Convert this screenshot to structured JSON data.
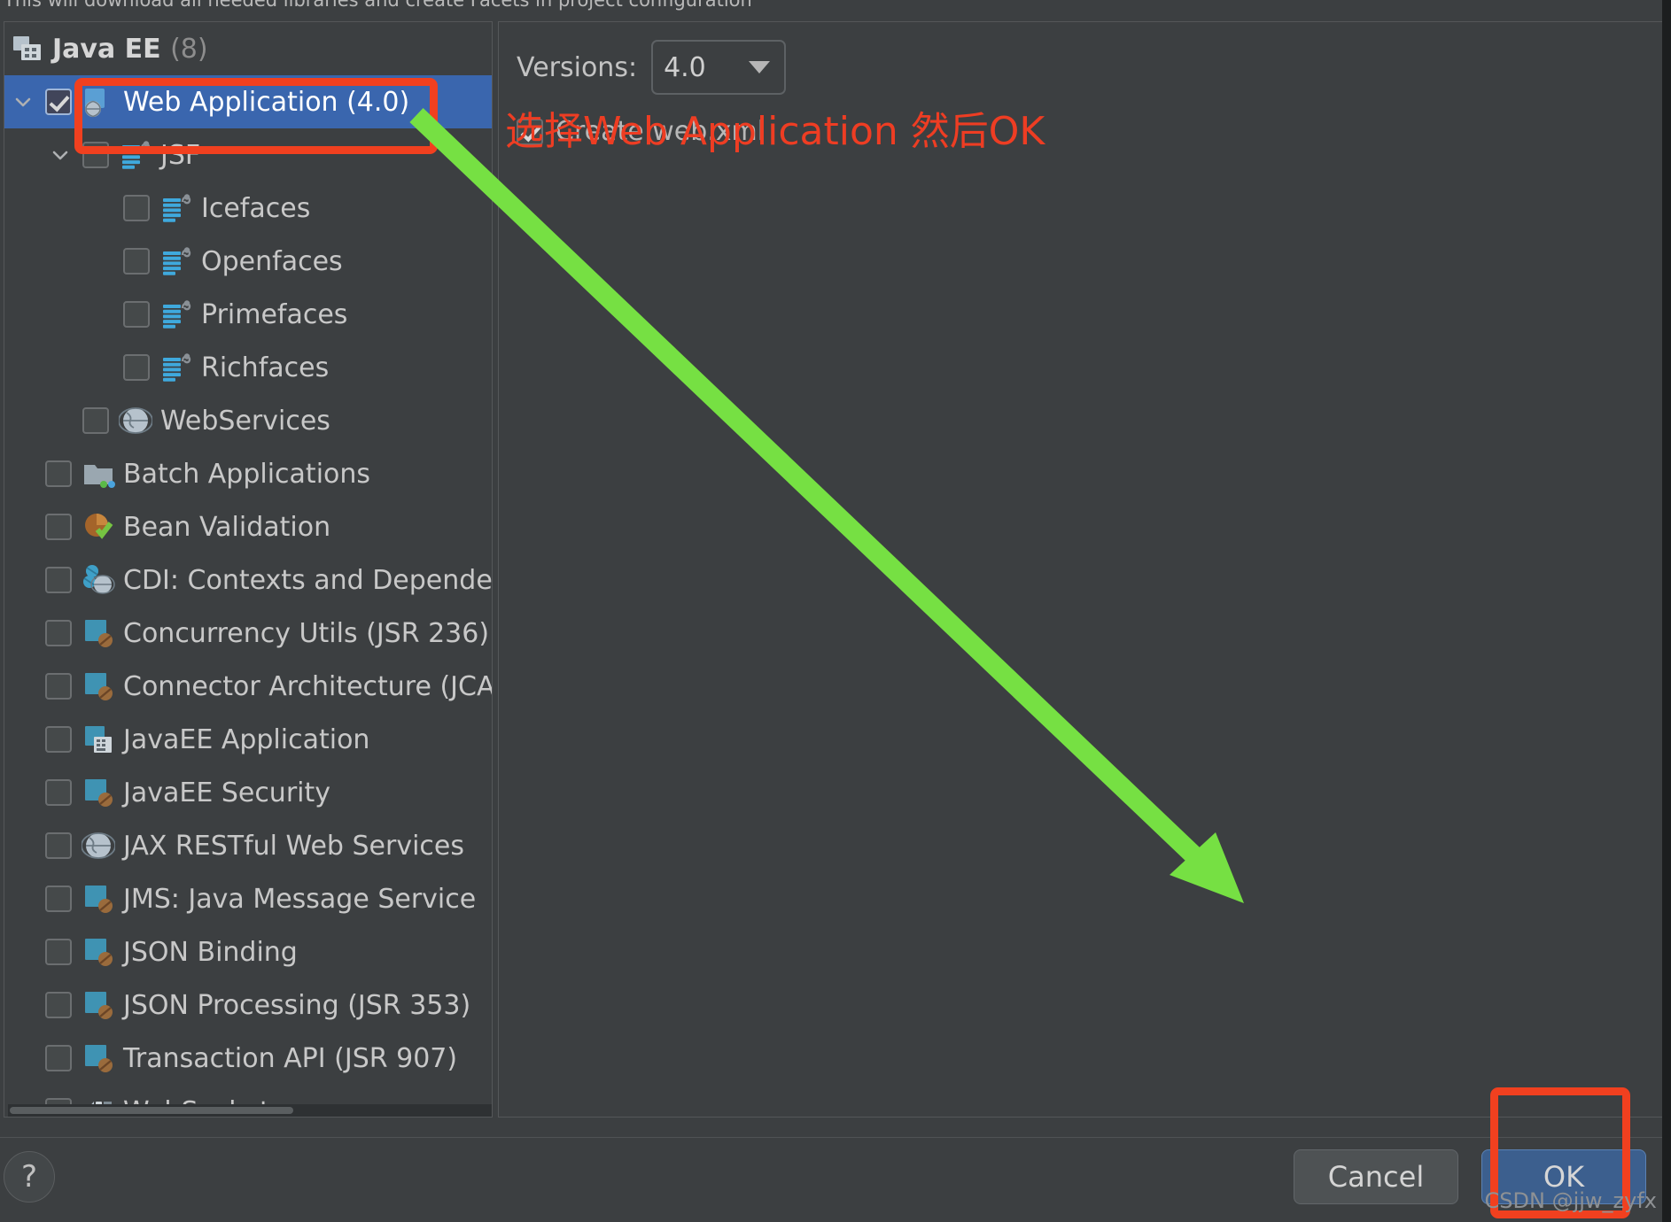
{
  "dialog": {
    "hint": "This will download all needed libraries and create Facets in project configuration",
    "help_label": "?"
  },
  "tree": {
    "group_label": "Java EE",
    "group_count": "(8)",
    "items": [
      {
        "label": "Web Application (4.0)",
        "level": 1,
        "checked": true,
        "selected": true,
        "expandable": true,
        "icon": "web-application-icon"
      },
      {
        "label": "JSF",
        "level": 2,
        "checked": false,
        "selected": false,
        "expandable": true,
        "icon": "jsf-icon"
      },
      {
        "label": "Icefaces",
        "level": 3,
        "checked": false,
        "selected": false,
        "expandable": false,
        "icon": "jsf-icon"
      },
      {
        "label": "Openfaces",
        "level": 3,
        "checked": false,
        "selected": false,
        "expandable": false,
        "icon": "jsf-icon"
      },
      {
        "label": "Primefaces",
        "level": 3,
        "checked": false,
        "selected": false,
        "expandable": false,
        "icon": "jsf-icon"
      },
      {
        "label": "Richfaces",
        "level": 3,
        "checked": false,
        "selected": false,
        "expandable": false,
        "icon": "jsf-icon"
      },
      {
        "label": "WebServices",
        "level": 2,
        "checked": false,
        "selected": false,
        "expandable": false,
        "icon": "globe-icon"
      },
      {
        "label": "Batch Applications",
        "level": 1,
        "checked": false,
        "selected": false,
        "expandable": false,
        "icon": "folder-icon"
      },
      {
        "label": "Bean Validation",
        "level": 1,
        "checked": false,
        "selected": false,
        "expandable": false,
        "icon": "bean-validation-icon"
      },
      {
        "label": "CDI: Contexts and Dependency Injection",
        "level": 1,
        "checked": false,
        "selected": false,
        "expandable": false,
        "icon": "cdi-icon"
      },
      {
        "label": "Concurrency Utils (JSR 236)",
        "level": 1,
        "checked": false,
        "selected": false,
        "expandable": false,
        "icon": "java-square-icon"
      },
      {
        "label": "Connector Architecture (JCA)",
        "level": 1,
        "checked": false,
        "selected": false,
        "expandable": false,
        "icon": "java-square-icon"
      },
      {
        "label": "JavaEE Application",
        "level": 1,
        "checked": false,
        "selected": false,
        "expandable": false,
        "icon": "javaee-application-icon"
      },
      {
        "label": "JavaEE Security",
        "level": 1,
        "checked": false,
        "selected": false,
        "expandable": false,
        "icon": "java-square-icon"
      },
      {
        "label": "JAX RESTful Web Services",
        "level": 1,
        "checked": false,
        "selected": false,
        "expandable": false,
        "icon": "globe-icon"
      },
      {
        "label": "JMS: Java Message Service",
        "level": 1,
        "checked": false,
        "selected": false,
        "expandable": false,
        "icon": "java-square-icon"
      },
      {
        "label": "JSON Binding",
        "level": 1,
        "checked": false,
        "selected": false,
        "expandable": false,
        "icon": "java-square-icon"
      },
      {
        "label": "JSON Processing (JSR 353)",
        "level": 1,
        "checked": false,
        "selected": false,
        "expandable": false,
        "icon": "java-square-icon"
      },
      {
        "label": "Transaction API (JSR 907)",
        "level": 1,
        "checked": false,
        "selected": false,
        "expandable": false,
        "icon": "java-square-icon"
      },
      {
        "label": "WebSocket",
        "level": 1,
        "checked": false,
        "selected": false,
        "expandable": false,
        "icon": "websocket-icon"
      }
    ]
  },
  "details": {
    "versions_label": "Versions:",
    "versions_value": "4.0",
    "create_webxml_label": "Create web.xml",
    "create_webxml_checked": true
  },
  "footer": {
    "cancel_label": "Cancel",
    "ok_label": "OK"
  },
  "annotations": {
    "instruction": "选择Web Application 然后OK",
    "watermark": "CSDN @jjw_zyfx",
    "highlight_color": "#f1401f",
    "arrow_color": "#76e043",
    "selection_color": "#3a66ae"
  }
}
